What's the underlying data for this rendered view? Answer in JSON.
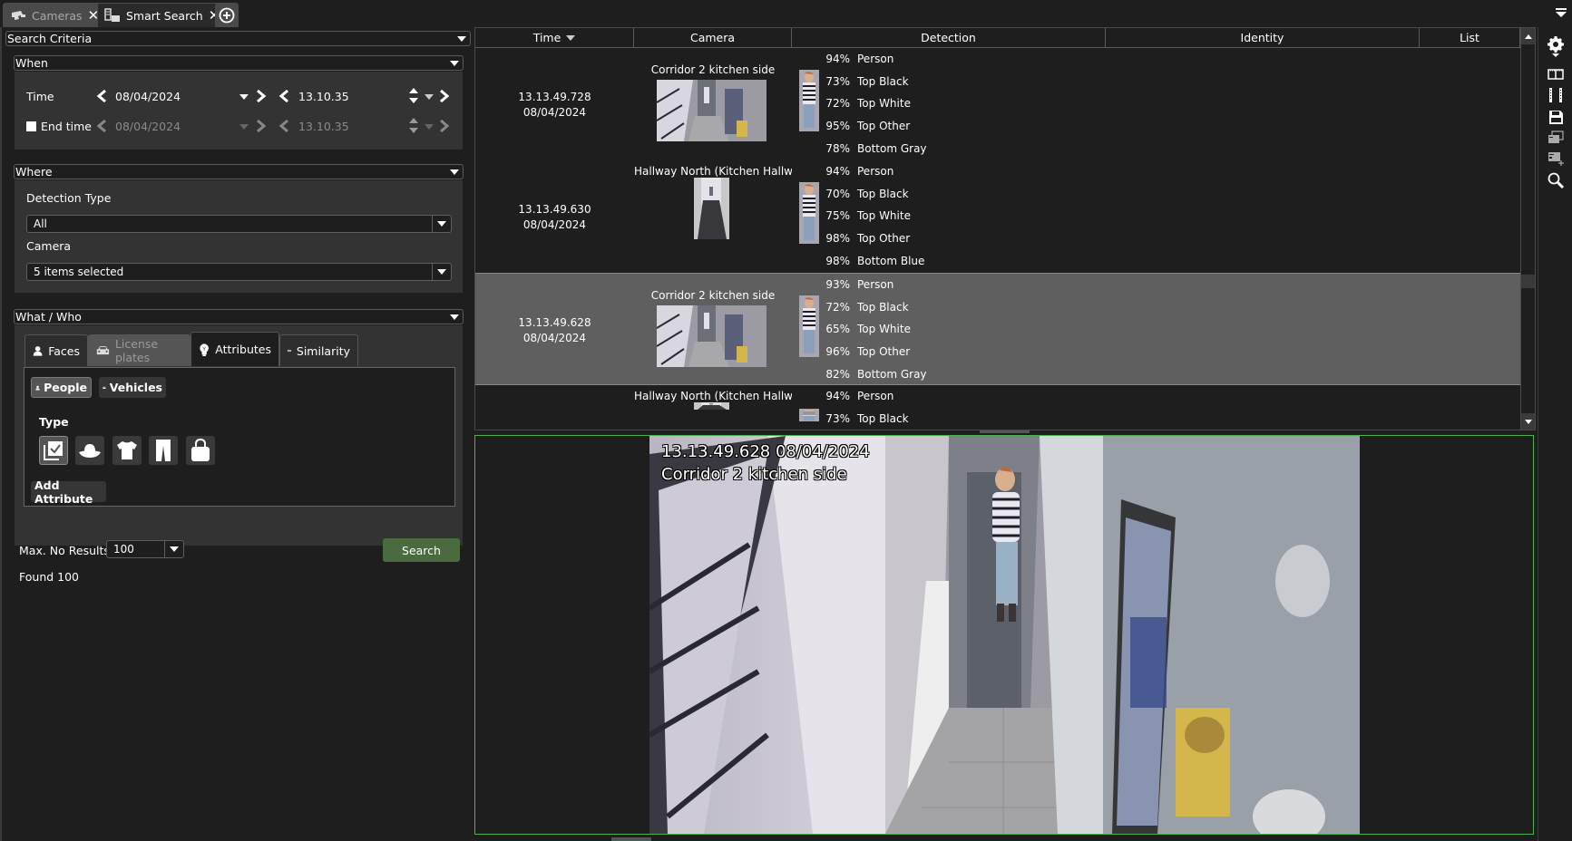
{
  "tabs": [
    {
      "label": "Cameras",
      "icon": "cctv-camera-icon",
      "active": false
    },
    {
      "label": "Smart Search",
      "icon": "smart-search-icon",
      "active": true
    }
  ],
  "search_criteria": {
    "title": "Search Criteria",
    "when": {
      "title": "When",
      "time_label": "Time",
      "time_date": "08/04/2024",
      "time_time": "13.10.35",
      "end_time_label": "End time",
      "end_time_checked": false,
      "end_date": "08/04/2024",
      "end_time": "13.10.35"
    },
    "where": {
      "title": "Where",
      "detection_type_label": "Detection Type",
      "detection_type_value": "All",
      "camera_label": "Camera",
      "camera_value": "5 items selected"
    },
    "what_who": {
      "title": "What / Who",
      "tabs": [
        {
          "label": "Faces",
          "icon": "person-icon",
          "state": "inactive"
        },
        {
          "label": "License plates",
          "icon": "car-icon",
          "state": "disabled"
        },
        {
          "label": "Attributes",
          "icon": "lightbulb-icon",
          "state": "active"
        },
        {
          "label": "Similarity",
          "icon": "similarity-icon",
          "state": "inactive"
        }
      ],
      "category_buttons": [
        {
          "label": "People",
          "icon": "person-icon",
          "selected": true
        },
        {
          "label": "Vehicles",
          "icon": "car-icon",
          "selected": false
        }
      ],
      "type_label": "Type",
      "type_buttons": [
        {
          "icon": "all-types-check-icon",
          "selected": true
        },
        {
          "icon": "hat-icon",
          "selected": false
        },
        {
          "icon": "tshirt-icon",
          "selected": false
        },
        {
          "icon": "trousers-icon",
          "selected": false
        },
        {
          "icon": "bag-icon",
          "selected": false
        }
      ],
      "add_attribute_label": "Add Attribute"
    },
    "max_results_label": "Max. No Results",
    "max_results_value": "100",
    "search_button_label": "Search",
    "found_text": "Found 100"
  },
  "results": {
    "columns": [
      "Time",
      "Camera",
      "Detection",
      "Identity",
      "List"
    ],
    "sort_column": "Time",
    "rows": [
      {
        "time": "13.13.49.728",
        "date": "08/04/2024",
        "camera": "Corridor 2 kitchen side",
        "thumb": "wide",
        "selected": false,
        "detections": [
          {
            "pct": "94%",
            "label": "Person"
          },
          {
            "pct": "73%",
            "label": "Top Black"
          },
          {
            "pct": "72%",
            "label": "Top White"
          },
          {
            "pct": "95%",
            "label": "Top Other"
          },
          {
            "pct": "78%",
            "label": "Bottom Gray"
          }
        ]
      },
      {
        "time": "13.13.49.630",
        "date": "08/04/2024",
        "camera": "Hallway North (Kitchen Hallw",
        "thumb": "tall",
        "selected": false,
        "detections": [
          {
            "pct": "94%",
            "label": "Person"
          },
          {
            "pct": "70%",
            "label": "Top Black"
          },
          {
            "pct": "75%",
            "label": "Top White"
          },
          {
            "pct": "98%",
            "label": "Top Other"
          },
          {
            "pct": "98%",
            "label": "Bottom Blue"
          }
        ]
      },
      {
        "time": "13.13.49.628",
        "date": "08/04/2024",
        "camera": "Corridor 2 kitchen side",
        "thumb": "wide",
        "selected": true,
        "detections": [
          {
            "pct": "93%",
            "label": "Person"
          },
          {
            "pct": "72%",
            "label": "Top Black"
          },
          {
            "pct": "65%",
            "label": "Top White"
          },
          {
            "pct": "96%",
            "label": "Top Other"
          },
          {
            "pct": "82%",
            "label": "Bottom Gray"
          }
        ]
      },
      {
        "time": "",
        "date": "",
        "camera": "Hallway North (Kitchen Hallw",
        "thumb": "tall",
        "selected": false,
        "detections": [
          {
            "pct": "94%",
            "label": "Person"
          },
          {
            "pct": "73%",
            "label": "Top Black"
          }
        ]
      }
    ]
  },
  "toolbar": [
    {
      "icon": "settings-gear-icon"
    },
    {
      "icon": "split-view-icon"
    },
    {
      "icon": "film-strip-icon"
    },
    {
      "icon": "save-icon"
    },
    {
      "icon": "export-clips-icon"
    },
    {
      "icon": "add-to-list-icon"
    },
    {
      "icon": "search-magnifier-icon"
    }
  ],
  "video": {
    "timestamp": "13.13.49.628  08/04/2024",
    "camera_name": "Corridor 2 kitchen side"
  },
  "colors": {
    "accent_green": "#4caf50",
    "search_button": "#4a6a40",
    "selected_row": "#5f5f5f"
  }
}
